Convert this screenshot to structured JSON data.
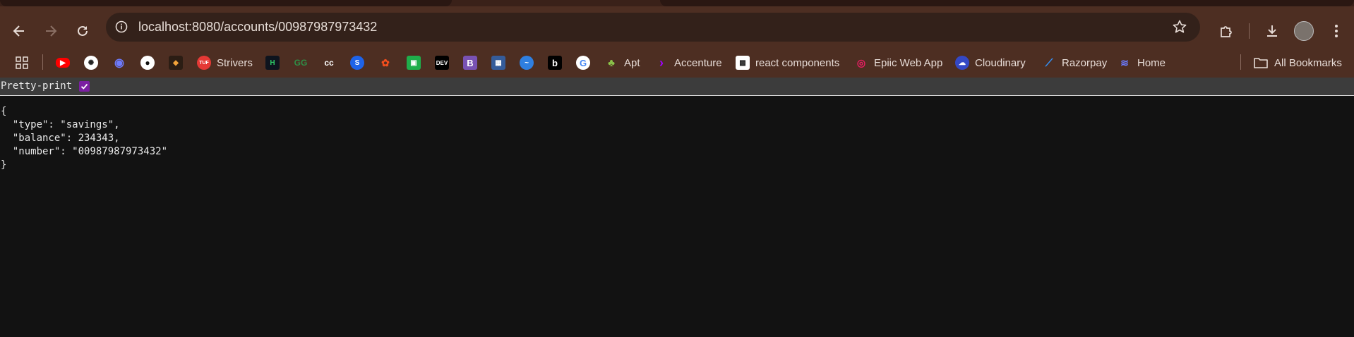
{
  "browser": {
    "url": "localhost:8080/accounts/00987987973432",
    "bookmarks": [
      {
        "label": "",
        "icon": "youtube-icon"
      },
      {
        "label": "",
        "icon": "chatgpt-icon"
      },
      {
        "label": "",
        "icon": "deepseek-icon"
      },
      {
        "label": "",
        "icon": "github-icon"
      },
      {
        "label": "",
        "icon": "app-icon"
      },
      {
        "label": "Strivers",
        "icon": "tuf-icon"
      },
      {
        "label": "",
        "icon": "hackerrank-icon"
      },
      {
        "label": "",
        "icon": "geeksforgeeks-icon"
      },
      {
        "label": "",
        "icon": "codechef-icon"
      },
      {
        "label": "",
        "icon": "scaler-icon"
      },
      {
        "label": "",
        "icon": "figma-icon"
      },
      {
        "label": "",
        "icon": "green-app-icon"
      },
      {
        "label": "",
        "icon": "dev-icon"
      },
      {
        "label": "",
        "icon": "bootstrap-icon"
      },
      {
        "label": "",
        "icon": "image-icon"
      },
      {
        "label": "",
        "icon": "chart-icon"
      },
      {
        "label": "",
        "icon": "bold-b-icon"
      },
      {
        "label": "",
        "icon": "google-icon"
      },
      {
        "label": "Apt",
        "icon": "mushroom-icon"
      },
      {
        "label": "Accenture",
        "icon": "accenture-icon"
      },
      {
        "label": "react components",
        "icon": "qr-icon"
      },
      {
        "label": "Epiic Web App",
        "icon": "swirl-icon"
      },
      {
        "label": "Cloudinary",
        "icon": "cloudinary-icon"
      },
      {
        "label": "Razorpay",
        "icon": "razorpay-icon"
      },
      {
        "label": "Home",
        "icon": "layers-icon"
      }
    ],
    "all_bookmarks_label": "All Bookmarks",
    "colors": {
      "frame": "#4d2e22",
      "omnibox": "#33211a",
      "text": "#e8ddd8"
    }
  },
  "viewer": {
    "pretty_print_label": "Pretty-print",
    "pretty_print_checked": true,
    "json_text": "{\n  \"type\": \"savings\",\n  \"balance\": 234343,\n  \"number\": \"00987987973432\"\n}"
  }
}
